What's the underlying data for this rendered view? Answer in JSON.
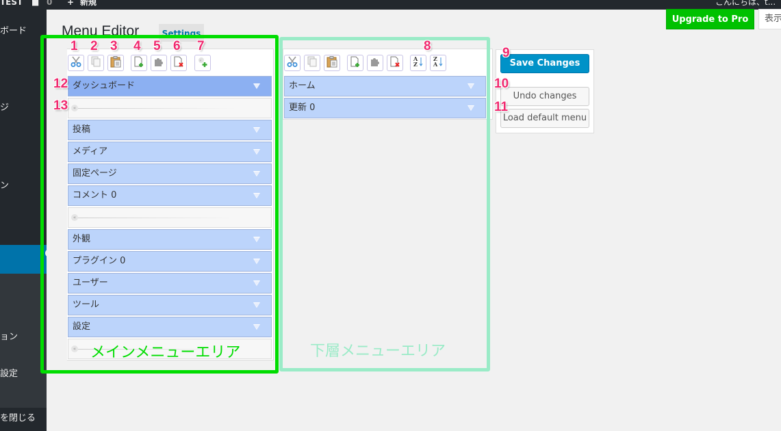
{
  "adminbar": {
    "site_name": "TEST",
    "comments_count": "0",
    "new_label": "新規",
    "greeting": "こんにちは、t..."
  },
  "sidebar": {
    "items": [
      {
        "label": "ボード"
      },
      {
        "label": "ジ"
      },
      {
        "label": "ン"
      },
      {
        "label": "ョン"
      },
      {
        "label": "設定"
      },
      {
        "label": "を閉じる"
      }
    ]
  },
  "header": {
    "title": "Menu Editor",
    "settings_tab": "Settings",
    "upgrade_button": "Upgrade to Pro",
    "screen_options": "表示"
  },
  "main_toolbar": [
    {
      "icon": "cut-icon",
      "annotation": "1"
    },
    {
      "icon": "copy-icon",
      "annotation": "2"
    },
    {
      "icon": "paste-icon",
      "annotation": "3"
    },
    {
      "icon": "new-menu-icon",
      "annotation": "4"
    },
    {
      "icon": "hide-plugin-icon",
      "annotation": "5"
    },
    {
      "icon": "delete-icon",
      "annotation": "6"
    },
    {
      "icon": "new-separator-icon",
      "annotation": "7"
    }
  ],
  "sub_toolbar": [
    {
      "icon": "cut-icon"
    },
    {
      "icon": "copy-icon"
    },
    {
      "icon": "paste-icon"
    },
    {
      "icon": "new-menu-icon"
    },
    {
      "icon": "hide-plugin-icon"
    },
    {
      "icon": "delete-icon"
    },
    {
      "icon": "sort-ascending-icon",
      "annotation": "8"
    },
    {
      "icon": "sort-descending-icon"
    }
  ],
  "main_menu": [
    {
      "type": "item",
      "label": "ダッシュボード",
      "selected": true,
      "annotation": "12"
    },
    {
      "type": "separator",
      "annotation": "13"
    },
    {
      "type": "item",
      "label": "投稿"
    },
    {
      "type": "item",
      "label": "メディア"
    },
    {
      "type": "item",
      "label": "固定ページ"
    },
    {
      "type": "item",
      "label": "コメント 0"
    },
    {
      "type": "separator"
    },
    {
      "type": "item",
      "label": "外観"
    },
    {
      "type": "item",
      "label": "プラグイン 0"
    },
    {
      "type": "item",
      "label": "ユーザー"
    },
    {
      "type": "item",
      "label": "ツール"
    },
    {
      "type": "item",
      "label": "設定"
    },
    {
      "type": "separator"
    }
  ],
  "sub_menu": [
    {
      "label": "ホーム"
    },
    {
      "label": "更新 0"
    }
  ],
  "actions": {
    "save": {
      "label": "Save Changes",
      "annotation": "9"
    },
    "undo": {
      "label": "Undo changes",
      "annotation": "10"
    },
    "load_default": {
      "label": "Load default menu",
      "annotation": "11"
    }
  },
  "area_labels": {
    "main": "メインメニューエリア",
    "sub": "下層メニューエリア"
  },
  "colors": {
    "main_area_highlight": "#00dd00",
    "sub_area_highlight": "#9aebc7",
    "annotation": "#f0286e",
    "upgrade": "#00c100",
    "save": "#0092c8",
    "menu_item": "#bcd4fb",
    "menu_item_selected": "#8cb0f2"
  }
}
